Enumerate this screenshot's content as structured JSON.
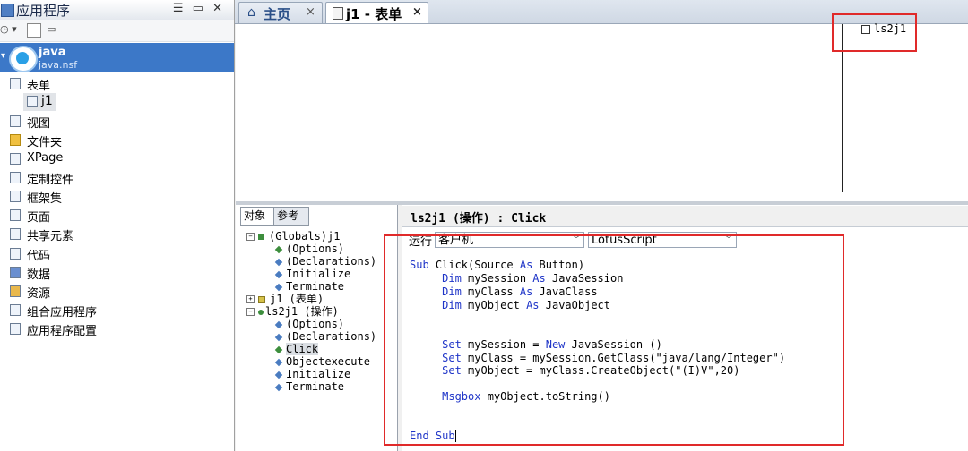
{
  "left_panel": {
    "title": "应用程序",
    "window_buttons": "☰ ▭ ✕",
    "app": {
      "name": "java",
      "file": "java.nsf"
    },
    "items": [
      {
        "label": "表单",
        "icon": "form-icon"
      },
      {
        "label": "j1",
        "icon": "form-doc-icon",
        "selected": true
      },
      {
        "label": "视图",
        "icon": "view-icon"
      },
      {
        "label": "文件夹",
        "icon": "folder-icon"
      },
      {
        "label": "XPage",
        "icon": "xpage-icon"
      },
      {
        "label": "定制控件",
        "icon": "custom-control-icon"
      },
      {
        "label": "框架集",
        "icon": "frameset-icon"
      },
      {
        "label": "页面",
        "icon": "page-icon"
      },
      {
        "label": "共享元素",
        "icon": "shared-elements-icon"
      },
      {
        "label": "代码",
        "icon": "code-icon"
      },
      {
        "label": "数据",
        "icon": "data-icon"
      },
      {
        "label": "资源",
        "icon": "resources-icon"
      },
      {
        "label": "组合应用程序",
        "icon": "composite-app-icon"
      },
      {
        "label": "应用程序配置",
        "icon": "app-config-icon"
      }
    ]
  },
  "tabs": [
    {
      "label": "主页",
      "close": "×"
    },
    {
      "label": "j1 - 表单",
      "close": "×"
    }
  ],
  "design": {
    "action_label": "ls2j1"
  },
  "object_panel": {
    "tabs": [
      "对象",
      "参考"
    ],
    "tree": [
      "(Globals)j1",
      "(Options)",
      "(Declarations)",
      "Initialize",
      "Terminate",
      "j1 (表单)",
      "ls2j1 (操作)",
      "(Options)",
      "(Declarations)",
      "Click",
      "Objectexecute",
      "Initialize",
      "Terminate"
    ]
  },
  "code_pane": {
    "title": "ls2j1 (操作) : Click",
    "run_label": "运行",
    "run_value": "客户机",
    "language_value": "LotusScript",
    "lines": [
      "Sub Click(Source As Button)",
      "     Dim mySession As JavaSession",
      "     Dim myClass As JavaClass",
      "     Dim myObject As JavaObject",
      "",
      "",
      "     Set mySession = New JavaSession ()",
      "     Set myClass = mySession.GetClass(\"java/lang/Integer\")",
      "     Set myObject = myClass.CreateObject(\"(I)V\",20)",
      "",
      "     Msgbox myObject.toString()",
      "",
      "",
      "End Sub"
    ]
  },
  "colors": {
    "selection_blue": "#3c78c8",
    "highlight_red": "#e02a2a",
    "keyword_blue": "#1f35c8"
  }
}
